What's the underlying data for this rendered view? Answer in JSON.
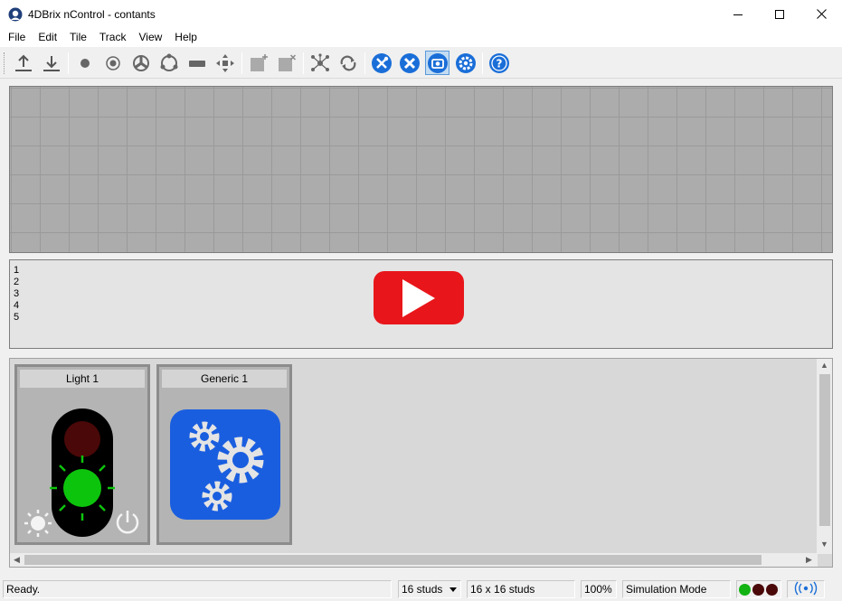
{
  "window": {
    "title": "4DBrix nControl - contants"
  },
  "menu": [
    "File",
    "Edit",
    "Tile",
    "Track",
    "View",
    "Help"
  ],
  "toolbar": {
    "buttons": [
      {
        "name": "upload-icon"
      },
      {
        "name": "download-icon"
      },
      {
        "name": "point-icon"
      },
      {
        "name": "signal-icon"
      },
      {
        "name": "turntable-icon"
      },
      {
        "name": "loop-icon"
      },
      {
        "name": "sensor-icon"
      },
      {
        "name": "crossing-icon"
      },
      {
        "name": "add-tile-icon"
      },
      {
        "name": "remove-tile-icon"
      },
      {
        "name": "network-icon"
      },
      {
        "name": "refresh-icon"
      },
      {
        "name": "tools-icon"
      },
      {
        "name": "config-tools-icon"
      },
      {
        "name": "simulation-icon"
      },
      {
        "name": "settings-icon"
      },
      {
        "name": "help-icon"
      }
    ],
    "accent": "#1a6ed8"
  },
  "script": {
    "line_numbers": [
      "1",
      "2",
      "3",
      "4",
      "5"
    ]
  },
  "tiles": [
    {
      "label": "Light 1"
    },
    {
      "label": "Generic 1"
    }
  ],
  "status": {
    "text": "Ready.",
    "stud_select": "16 studs",
    "grid_size": "16 x 16 studs",
    "zoom": "100%",
    "mode": "Simulation Mode",
    "indicators": [
      "#12b312",
      "#4a0808",
      "#4a0808"
    ]
  }
}
